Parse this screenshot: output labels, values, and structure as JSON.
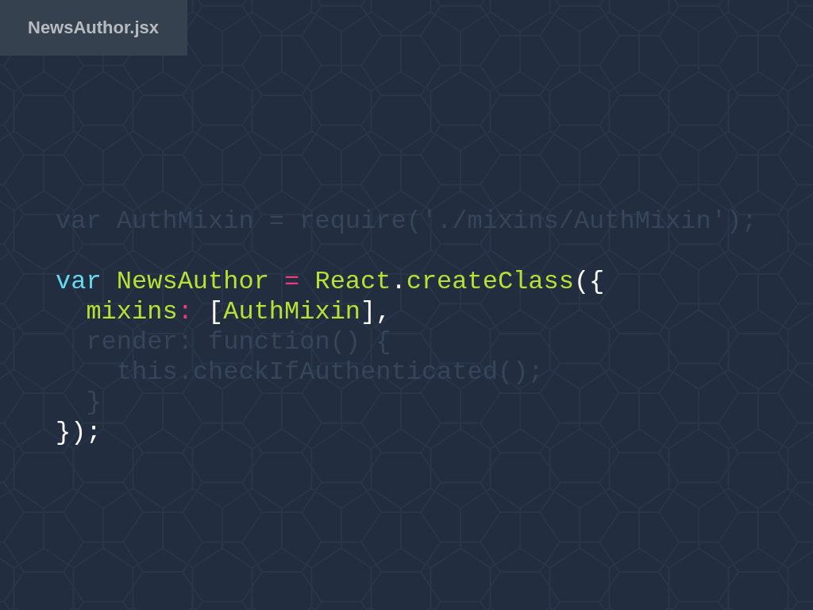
{
  "file_tab": {
    "label": "NewsAuthor.jsx"
  },
  "code": {
    "blocks": [
      {
        "lines": [
          {
            "dimmed": true,
            "text": "var AuthMixin = require('./mixins/AuthMixin');"
          }
        ]
      },
      {
        "lines": [
          {
            "dimmed": false,
            "tokens": [
              {
                "kind": "keyword",
                "text": "var "
              },
              {
                "kind": "name",
                "text": "NewsAuthor "
              },
              {
                "kind": "operator",
                "text": "= "
              },
              {
                "kind": "name",
                "text": "React"
              },
              {
                "kind": "punct",
                "text": "."
              },
              {
                "kind": "name",
                "text": "createClass"
              },
              {
                "kind": "punct",
                "text": "({"
              }
            ],
            "children": [
              {
                "dimmed": false,
                "tokens": [
                  {
                    "kind": "name",
                    "text": "mixins"
                  },
                  {
                    "kind": "operator",
                    "text": ": "
                  },
                  {
                    "kind": "punct",
                    "text": "["
                  },
                  {
                    "kind": "name",
                    "text": "AuthMixin"
                  },
                  {
                    "kind": "punct",
                    "text": "],"
                  }
                ]
              },
              {
                "dimmed": true,
                "text": "render: function() {",
                "children": [
                  {
                    "dimmed": true,
                    "text": "this.checkIfAuthenticated();"
                  }
                ]
              },
              {
                "dimmed": true,
                "text": "}"
              }
            ]
          },
          {
            "dimmed": false,
            "tokens": [
              {
                "kind": "punct",
                "text": "});"
              }
            ]
          }
        ]
      }
    ]
  }
}
